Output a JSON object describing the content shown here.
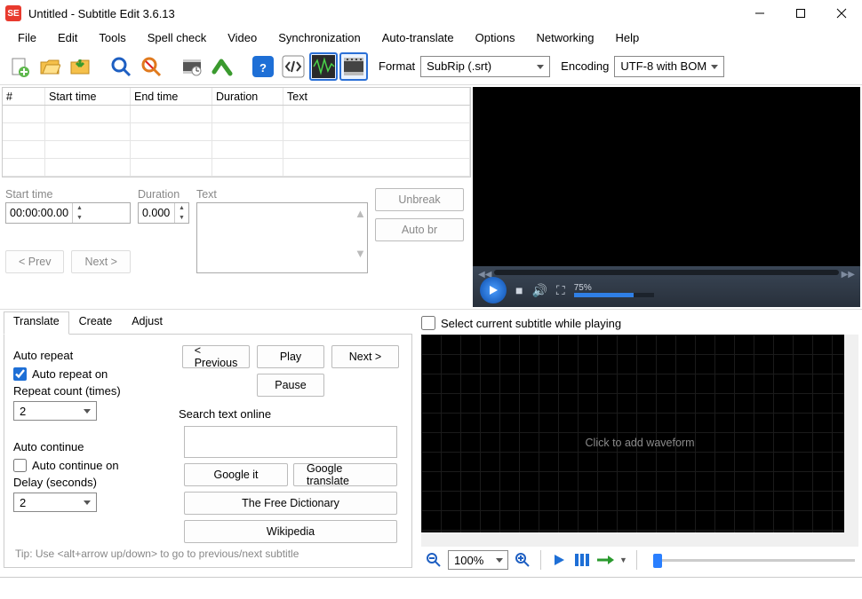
{
  "window": {
    "title": "Untitled - Subtitle Edit 3.6.13",
    "app_icon_text": "SE"
  },
  "menu": [
    "File",
    "Edit",
    "Tools",
    "Spell check",
    "Video",
    "Synchronization",
    "Auto-translate",
    "Options",
    "Networking",
    "Help"
  ],
  "toolbar": {
    "format_label": "Format",
    "format_value": "SubRip (.srt)",
    "encoding_label": "Encoding",
    "encoding_value": "UTF-8 with BOM"
  },
  "grid": {
    "headers": {
      "num": "#",
      "start": "Start time",
      "end": "End time",
      "dur": "Duration",
      "text": "Text"
    },
    "rows": [
      {
        "num": "",
        "start": "",
        "end": "",
        "dur": "",
        "text": ""
      },
      {
        "num": "",
        "start": "",
        "end": "",
        "dur": "",
        "text": ""
      },
      {
        "num": "",
        "start": "",
        "end": "",
        "dur": "",
        "text": ""
      },
      {
        "num": "",
        "start": "",
        "end": "",
        "dur": "",
        "text": ""
      }
    ]
  },
  "edit": {
    "start_label": "Start time",
    "start_value": "00:00:00.000",
    "dur_label": "Duration",
    "dur_value": "0.000",
    "text_label": "Text",
    "prev": "< Prev",
    "next": "Next >",
    "unbreak": "Unbreak",
    "autobr": "Auto br"
  },
  "video": {
    "volume_label": "75%",
    "volume_fill_percent": 75
  },
  "lower_tabs": [
    "Translate",
    "Create",
    "Adjust"
  ],
  "translate": {
    "auto_repeat_title": "Auto repeat",
    "auto_repeat_on": "Auto repeat on",
    "repeat_count_label": "Repeat count (times)",
    "repeat_count_value": "2",
    "auto_continue_title": "Auto continue",
    "auto_continue_on": "Auto continue on",
    "delay_label": "Delay (seconds)",
    "delay_value": "2",
    "prev": "< Previous",
    "play": "Play",
    "next": "Next >",
    "pause": "Pause",
    "search_label": "Search text online",
    "google_it": "Google it",
    "google_translate": "Google translate",
    "free_dict": "The Free Dictionary",
    "wikipedia": "Wikipedia",
    "tip": "Tip: Use <alt+arrow up/down> to go to previous/next subtitle"
  },
  "lower_right": {
    "select_label": "Select current subtitle while playing",
    "wave_msg": "Click to add waveform",
    "zoom_value": "100%"
  }
}
